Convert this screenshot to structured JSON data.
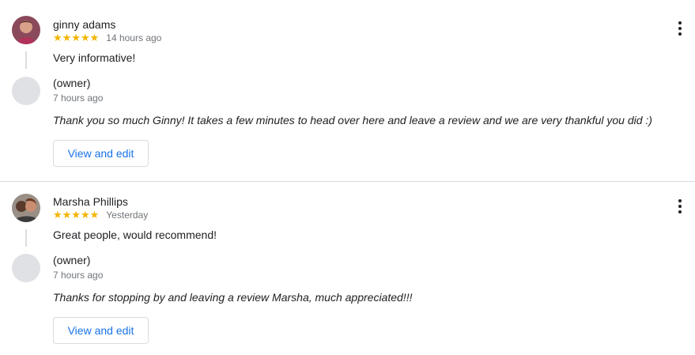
{
  "reviews": [
    {
      "reviewer_name": "ginny adams",
      "stars": "★★★★★",
      "rating": 5,
      "time": "14 hours ago",
      "text": "Very informative!",
      "owner_label": "(owner)",
      "owner_time": "7 hours ago",
      "owner_reply": "Thank you so much Ginny! It takes a few minutes to head over here and leave a review and we are very thankful you did :)",
      "edit_label": "View and edit"
    },
    {
      "reviewer_name": "Marsha Phillips",
      "stars": "★★★★★",
      "rating": 5,
      "time": "Yesterday",
      "text": "Great people, would recommend!",
      "owner_label": "(owner)",
      "owner_time": "7 hours ago",
      "owner_reply": "Thanks for stopping by and leaving a review Marsha, much appreciated!!!",
      "edit_label": "View and edit"
    }
  ],
  "colors": {
    "star": "#f4b400",
    "link": "#1a73e8",
    "muted": "#70757a",
    "divider": "#dadce0"
  }
}
